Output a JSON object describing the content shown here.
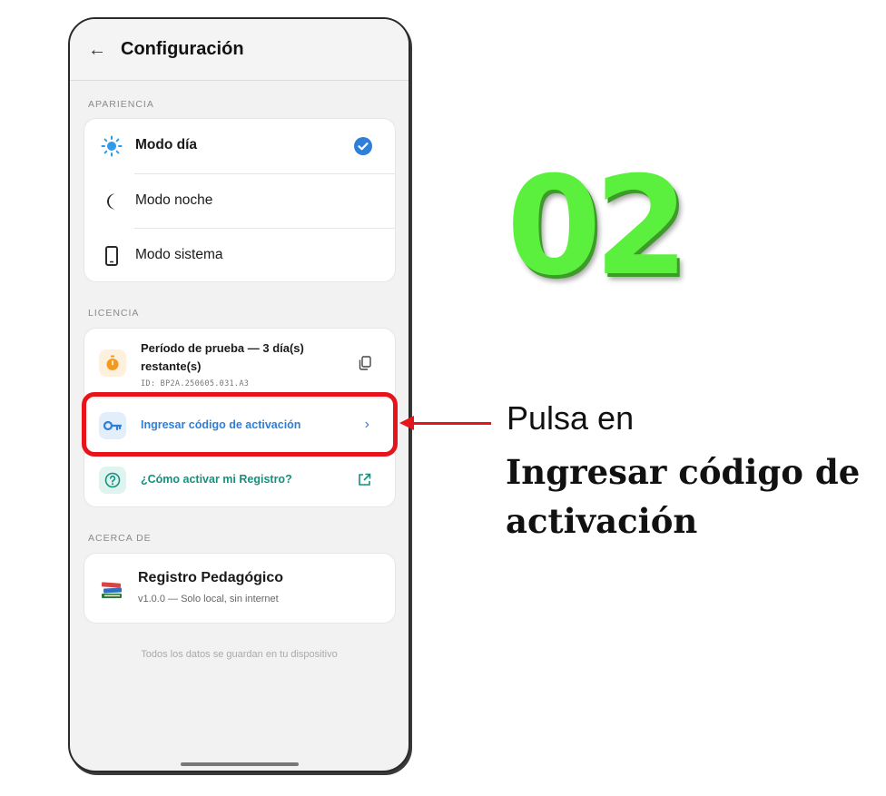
{
  "header": {
    "title": "Configuración"
  },
  "appearance": {
    "section_label": "APARIENCIA",
    "items": [
      {
        "label": "Modo día",
        "icon": "sun-icon",
        "selected": true
      },
      {
        "label": "Modo noche",
        "icon": "moon-icon",
        "selected": false
      },
      {
        "label": "Modo sistema",
        "icon": "phone-icon",
        "selected": false
      }
    ]
  },
  "license": {
    "section_label": "LICENCIA",
    "trial_title": "Período de prueba — 3 día(s) restante(s)",
    "device_id": "ID: BP2A.250605.031.A3",
    "activate_label": "Ingresar código de activación",
    "help_label": "¿Cómo activar mi Registro?"
  },
  "about": {
    "section_label": "ACERCA DE",
    "app_name": "Registro Pedagógico",
    "version_line": "v1.0.0 — Solo local, sin internet"
  },
  "footer": {
    "note": "Todos los datos se guardan en tu dispositivo"
  },
  "callout": {
    "step_number": "02",
    "prefix": "Pulsa en",
    "target": "Ingresar código de activación"
  },
  "colors": {
    "accent_blue": "#2f7fd8",
    "accent_teal": "#14917f",
    "highlight_red": "#e8141b",
    "step_green": "#5cf03e"
  }
}
